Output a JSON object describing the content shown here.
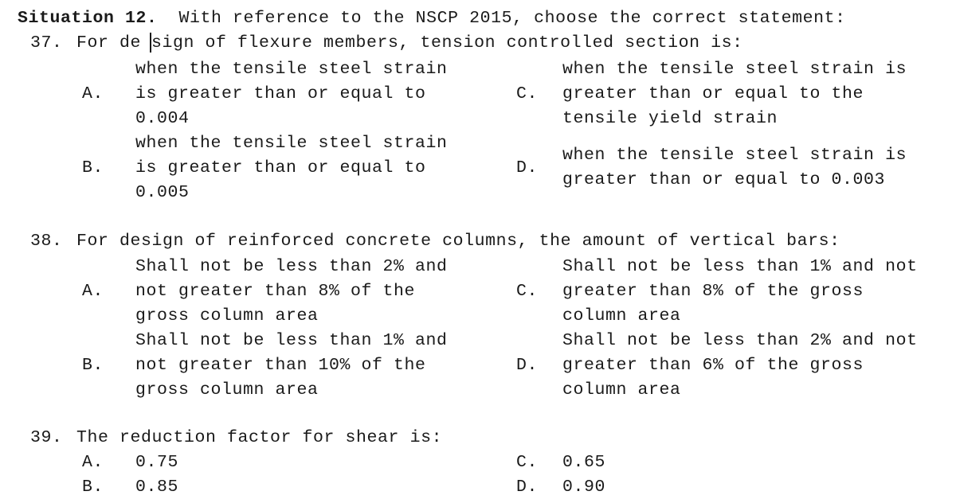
{
  "document": {
    "situation": {
      "label": "Situation 12.",
      "text": "  With reference to the NSCP 2015, choose the correct statement:"
    },
    "questions": [
      {
        "number": "37.",
        "stem_before_caret": "For de",
        "stem_after_caret": "sign of flexure members, tension controlled section is:",
        "stem_full": "For design of flexure members, tension controlled section is:",
        "options": [
          {
            "letter": "A.",
            "text": "when the tensile steel strain\nis greater than or equal to\n0.004"
          },
          {
            "letter": "B.",
            "text": "when the tensile steel strain\nis greater than or equal to\n0.005"
          },
          {
            "letter": "C.",
            "text": "when the tensile steel strain is\ngreater than or equal to the\ntensile yield strain"
          },
          {
            "letter": "D.",
            "text": "when the tensile steel strain is\ngreater than or equal to 0.003"
          }
        ]
      },
      {
        "number": "38.",
        "stem_full": "For design of reinforced concrete columns, the amount of vertical bars:",
        "options": [
          {
            "letter": "A.",
            "text": "Shall not be less than 2% and\nnot greater than 8% of the\ngross column area"
          },
          {
            "letter": "B.",
            "text": "Shall not be less than 1% and\nnot greater than 10% of the\ngross column area"
          },
          {
            "letter": "C.",
            "text": "Shall not be less than 1% and not\ngreater than 8% of the gross\ncolumn area"
          },
          {
            "letter": "D.",
            "text": "Shall not be less than 2% and not\ngreater than 6% of the gross\ncolumn area"
          }
        ]
      },
      {
        "number": "39.",
        "stem_full": "The reduction factor for shear is:",
        "options": [
          {
            "letter": "A.",
            "text": "0.75"
          },
          {
            "letter": "B.",
            "text": "0.85"
          },
          {
            "letter": "C.",
            "text": "0.65"
          },
          {
            "letter": "D.",
            "text": "0.90"
          }
        ]
      }
    ]
  },
  "colors": {
    "page_background": "#ffffff",
    "text": "#1a1a1a"
  }
}
